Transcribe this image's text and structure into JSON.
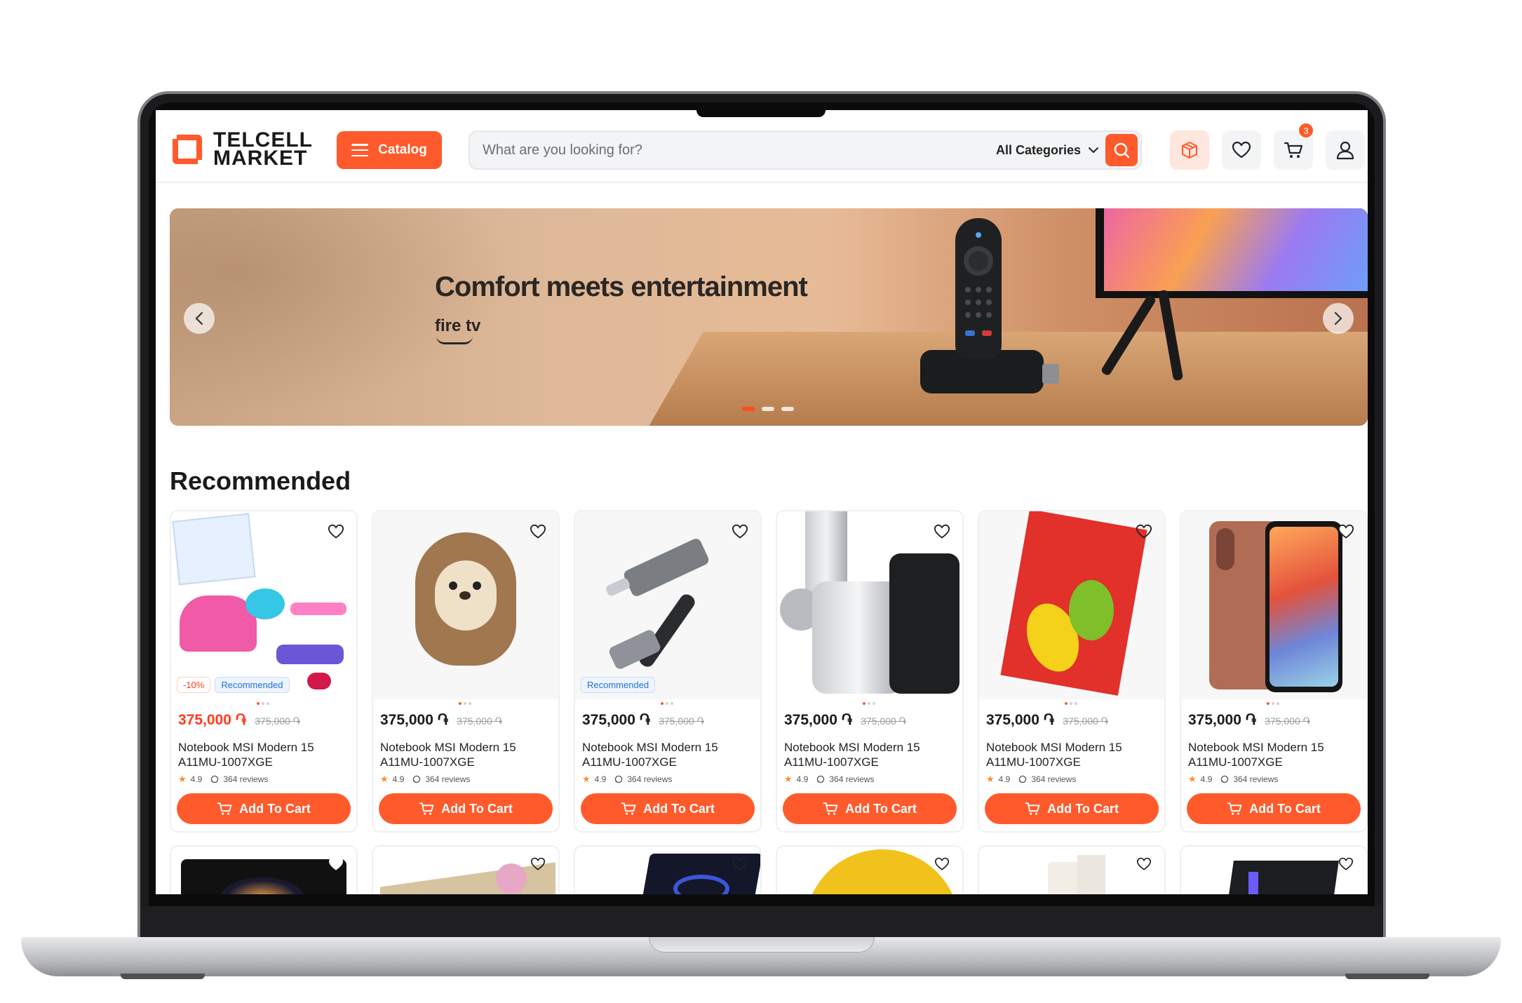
{
  "header": {
    "logo_line1": "TELCELL",
    "logo_line2": "MARKET",
    "catalog_label": "Catalog",
    "search_placeholder": "What are you looking for?",
    "category_label": "All Categories",
    "cart_count": "3"
  },
  "banner": {
    "title": "Comfort meets entertainment",
    "brand": "fire tv",
    "slides": 3,
    "active_slide": 1
  },
  "recommended": {
    "title": "Recommended",
    "products": [
      {
        "price": "375,000 ֏",
        "old_price": "375,000 ֏",
        "name": "Notebook MSI Modern 15 A11MU-1007XGE",
        "rating": "4.9",
        "reviews": "364 reviews",
        "button": "Add To Cart",
        "discount_tag": "-10%",
        "rec_tag": "Recommended",
        "price_color": "#ff3b1c"
      },
      {
        "price": "375,000 ֏",
        "old_price": "375,000 ֏",
        "name": "Notebook MSI Modern 15 A11MU-1007XGE",
        "rating": "4.9",
        "reviews": "364 reviews",
        "button": "Add To Cart"
      },
      {
        "price": "375,000 ֏",
        "old_price": "375,000 ֏",
        "name": "Notebook MSI Modern 15 A11MU-1007XGE",
        "rating": "4.9",
        "reviews": "364 reviews",
        "button": "Add To Cart",
        "rec_tag": "Recommended"
      },
      {
        "price": "375,000 ֏",
        "old_price": "375,000 ֏",
        "name": "Notebook MSI Modern 15 A11MU-1007XGE",
        "rating": "4.9",
        "reviews": "364 reviews",
        "button": "Add To Cart"
      },
      {
        "price": "375,000 ֏",
        "old_price": "375,000 ֏",
        "name": "Notebook MSI Modern 15 A11MU-1007XGE",
        "rating": "4.9",
        "reviews": "364 reviews",
        "button": "Add To Cart"
      },
      {
        "price": "375,000 ֏",
        "old_price": "375,000 ֏",
        "name": "Notebook MSI Modern 15 A11MU-1007XGE",
        "rating": "4.9",
        "reviews": "364 reviews",
        "button": "Add To Cart"
      }
    ]
  },
  "colors": {
    "accent": "#ff5a2c",
    "discount_price": "#ff3b1c"
  },
  "icons": [
    "hamburger-icon",
    "chevron-down-icon",
    "search-icon",
    "box-icon",
    "heart-icon",
    "cart-icon",
    "user-icon",
    "chevron-left-icon",
    "chevron-right-icon",
    "star-icon",
    "chat-icon"
  ]
}
